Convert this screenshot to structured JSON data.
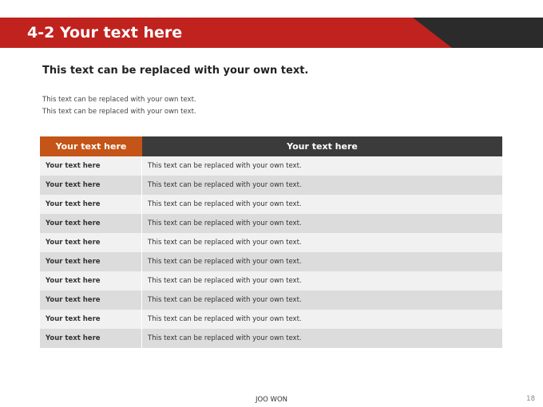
{
  "header": {
    "title": "4-2 Your text here",
    "colors": {
      "red": "#c0221e",
      "dark": "#2b2b2b"
    }
  },
  "subtitle": "This text can be replaced with your own text.",
  "body_lines": [
    "This text can be replaced with your own text.",
    "This text can be replaced with your own text."
  ],
  "table": {
    "headers": [
      "Your text here",
      "Your text here"
    ],
    "header_colors": [
      "#c45417",
      "#3b3b3b"
    ],
    "rows": [
      [
        "Your text here",
        "This text can be replaced with your own text."
      ],
      [
        "Your text here",
        "This text can be replaced with your own text."
      ],
      [
        "Your text here",
        "This text can be replaced with your own text."
      ],
      [
        "Your text here",
        "This text can be replaced with your own text."
      ],
      [
        "Your text here",
        "This text can be replaced with your own text."
      ],
      [
        "Your text here",
        "This text can be replaced with your own text."
      ],
      [
        "Your text here",
        "This text can be replaced with your own text."
      ],
      [
        "Your text here",
        "This text can be replaced with your own text."
      ],
      [
        "Your text here",
        "This text can be replaced with your own text."
      ],
      [
        "Your text here",
        "This text can be replaced with your own text."
      ]
    ]
  },
  "footer": {
    "author": "JOO WON",
    "page_number": "18"
  }
}
